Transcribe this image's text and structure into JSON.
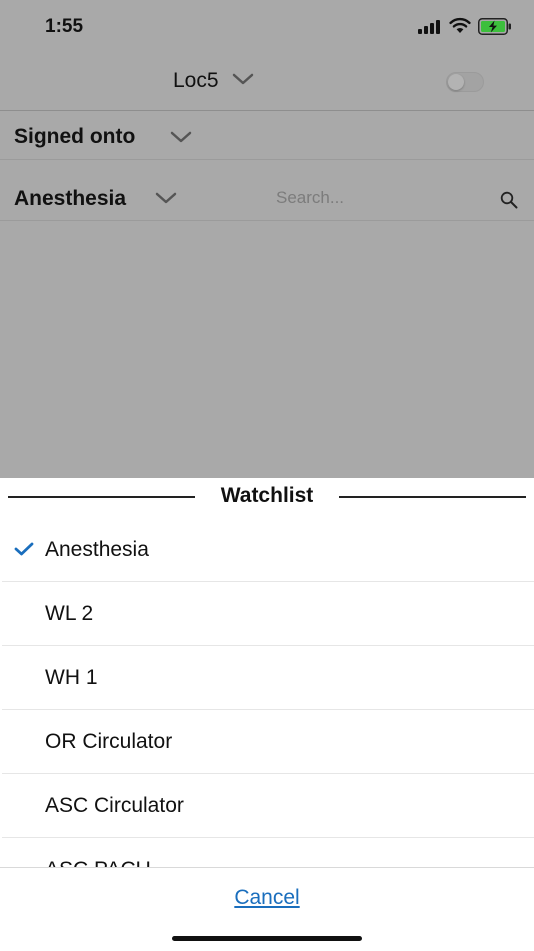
{
  "status_bar": {
    "time": "1:55"
  },
  "header": {
    "location": "Loc5"
  },
  "signed": {
    "label": "Signed onto"
  },
  "filter": {
    "watchlist_label": "Anesthesia",
    "search_placeholder": "Search..."
  },
  "sheet": {
    "title": "Watchlist",
    "items": [
      {
        "label": "Anesthesia",
        "selected": true
      },
      {
        "label": "WL 2",
        "selected": false
      },
      {
        "label": "WH 1",
        "selected": false
      },
      {
        "label": "OR Circulator",
        "selected": false
      },
      {
        "label": "ASC Circulator",
        "selected": false
      },
      {
        "label": "ASC PACU",
        "selected": false
      }
    ],
    "cancel_label": "Cancel"
  },
  "colors": {
    "accent": "#1a6ebd",
    "overlay": "#a9a9a9",
    "battery_charge": "#3dbf3d"
  },
  "icons": {
    "selected": "checkmark-icon",
    "dropdown": "chevron-down-icon",
    "search": "search-icon"
  }
}
